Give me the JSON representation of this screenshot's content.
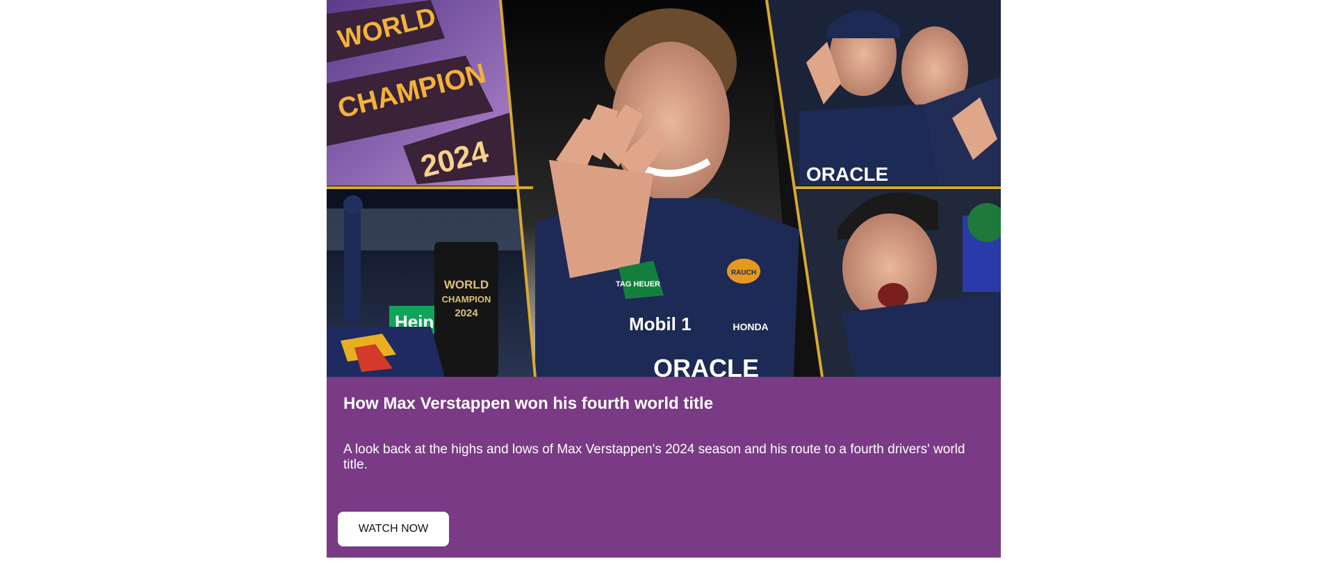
{
  "article": {
    "title": "How Max Verstappen won his fourth world title",
    "description": "A look back at the highs and lows of Max Verstappen's 2024 season and his route to a fourth drivers' world title.",
    "cta_label": "WATCH NOW"
  },
  "hero_image": {
    "sign_lines": [
      "WORLD",
      "CHAMPION",
      "2024"
    ],
    "trophy_lines": [
      "WORLD",
      "CHAMPION",
      "2024"
    ],
    "suit_logos": [
      "TAG HEUER",
      "Mobil 1",
      "ORACLE",
      "RAUCH",
      "HONDA"
    ],
    "bg_tags": [
      "Heine"
    ]
  },
  "colors": {
    "panel": "#7a3a85",
    "button_bg": "#ffffff",
    "button_text": "#111111",
    "gold_divider": "#d7a934",
    "suit_navy": "#1c2a55"
  }
}
